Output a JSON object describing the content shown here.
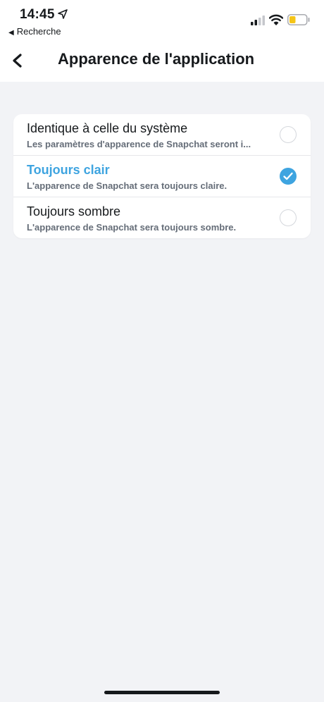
{
  "status_bar": {
    "time": "14:45",
    "back_app_label": "Recherche",
    "icons": [
      "location-arrow-icon",
      "cellular-signal-icon",
      "wifi-icon",
      "battery-low-icon"
    ]
  },
  "header": {
    "title": "Apparence de l'application",
    "back_icon": "chevron-left-icon"
  },
  "options": [
    {
      "title": "Identique à celle du système",
      "subtitle": "Les paramètres d'apparence de Snapchat seront i...",
      "selected": false
    },
    {
      "title": "Toujours clair",
      "subtitle": "L'apparence de Snapchat sera toujours claire.",
      "selected": true
    },
    {
      "title": "Toujours sombre",
      "subtitle": "L'apparence de Snapchat sera toujours sombre.",
      "selected": false
    }
  ],
  "colors": {
    "accent": "#3ea4e0",
    "background": "#f2f3f6",
    "card": "#ffffff",
    "text": "#16191c",
    "subtext": "#656d78",
    "battery": "#f5c518"
  }
}
